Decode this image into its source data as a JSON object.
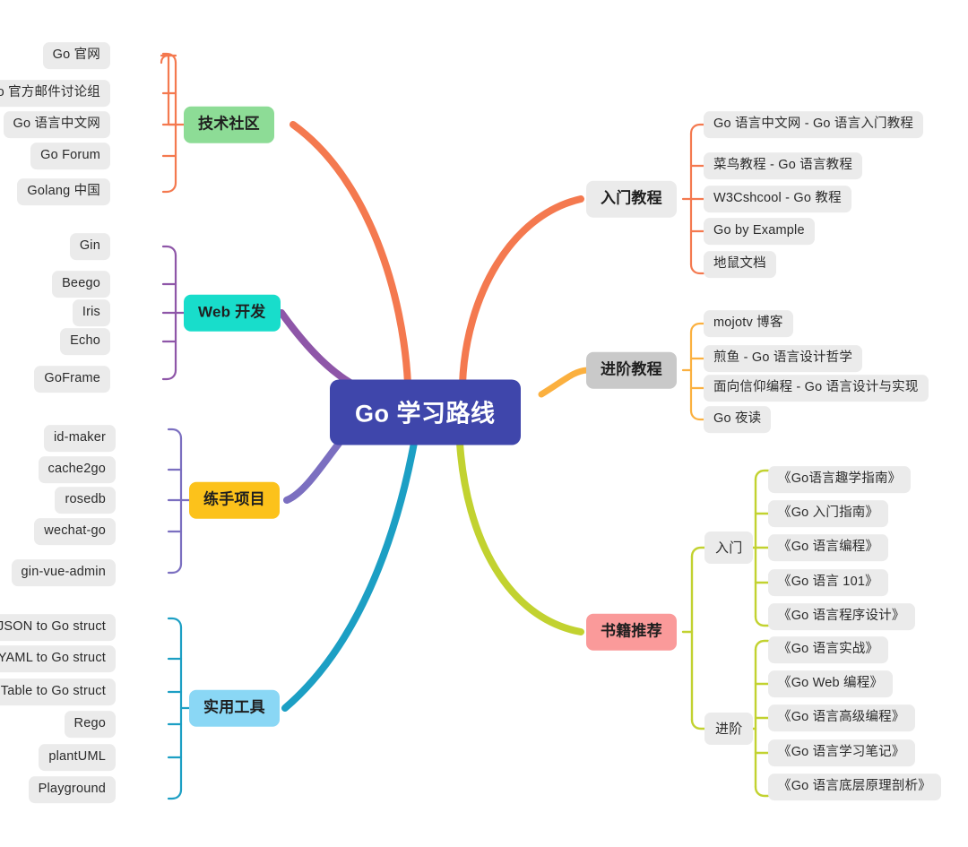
{
  "title": "Go 学习路线",
  "root": {
    "label": "Go 学习路线",
    "color": "#3f46ab",
    "text_color": "#ffffff"
  },
  "palette": {
    "tech_community": "#8ddc96",
    "web_dev": "#18ddcb",
    "practice_projects": "#fcc21b",
    "tools": "#8ad7f5",
    "beginner_tutorials": "#f4794f",
    "advanced_tutorials": "#fbb03f",
    "books": "#fa9a9a",
    "books_line": "#c2d230",
    "leaf_chip": "#ebebeb",
    "branch_grey": "#c9c9c9",
    "purple_line": "#8e56a8",
    "orange_line": "#f4794f",
    "cyan_line": "#1c9fc4"
  },
  "branches": [
    {
      "id": "tech-community",
      "label": "技术社区",
      "side": "left",
      "style": "green",
      "line_color": "#f4794f",
      "children": [
        {
          "label": "Go 官网"
        },
        {
          "label": "Go 官方邮件讨论组"
        },
        {
          "label": "Go 语言中文网"
        },
        {
          "label": "Go Forum"
        },
        {
          "label": "Golang 中国"
        }
      ]
    },
    {
      "id": "web-dev",
      "label": "Web 开发",
      "side": "left",
      "style": "cyan",
      "line_color": "#8e56a8",
      "children": [
        {
          "label": "Gin"
        },
        {
          "label": "Beego"
        },
        {
          "label": "Iris"
        },
        {
          "label": "Echo"
        },
        {
          "label": "GoFrame"
        }
      ]
    },
    {
      "id": "practice-projects",
      "label": "练手项目",
      "side": "left",
      "style": "amber",
      "line_color": "#7b6fc0",
      "children": [
        {
          "label": "id-maker"
        },
        {
          "label": "cache2go"
        },
        {
          "label": "rosedb"
        },
        {
          "label": "wechat-go"
        },
        {
          "label": "gin-vue-admin"
        }
      ]
    },
    {
      "id": "tools",
      "label": "实用工具",
      "side": "left",
      "style": "sky",
      "line_color": "#1c9fc4",
      "children": [
        {
          "label": "JSON to Go struct"
        },
        {
          "label": "YAML to Go struct"
        },
        {
          "label": "Table to Go struct"
        },
        {
          "label": "Rego"
        },
        {
          "label": "plantUML"
        },
        {
          "label": "Playground"
        }
      ]
    },
    {
      "id": "beginner-tutorials",
      "label": "入门教程",
      "side": "right",
      "style": "plain",
      "line_color": "#f4794f",
      "children": [
        {
          "label": "Go 语言中文网 - Go 语言入门教程"
        },
        {
          "label": "菜鸟教程 - Go 语言教程"
        },
        {
          "label": "W3Cshcool - Go 教程"
        },
        {
          "label": "Go by Example"
        },
        {
          "label": "地鼠文档"
        }
      ]
    },
    {
      "id": "advanced-tutorials",
      "label": "进阶教程",
      "side": "right",
      "style": "grey2",
      "line_color": "#fbb03f",
      "children": [
        {
          "label": "mojotv 博客"
        },
        {
          "label": "煎鱼 - Go 语言设计哲学"
        },
        {
          "label": "面向信仰编程 - Go 语言设计与实现"
        },
        {
          "label": "Go 夜读"
        }
      ]
    },
    {
      "id": "books",
      "label": "书籍推荐",
      "side": "right",
      "style": "pink",
      "line_color": "#c2d230",
      "groups": [
        {
          "label": "入门",
          "children": [
            {
              "label": "《Go语言趣学指南》"
            },
            {
              "label": "《Go 入门指南》"
            },
            {
              "label": "《Go 语言编程》"
            },
            {
              "label": "《Go 语言 101》"
            },
            {
              "label": "《Go 语言程序设计》"
            }
          ]
        },
        {
          "label": "进阶",
          "children": [
            {
              "label": "《Go 语言实战》"
            },
            {
              "label": "《Go Web 编程》"
            },
            {
              "label": "《Go 语言高级编程》"
            },
            {
              "label": "《Go 语言学习笔记》"
            },
            {
              "label": "《Go 语言底层原理剖析》"
            }
          ]
        }
      ]
    }
  ]
}
